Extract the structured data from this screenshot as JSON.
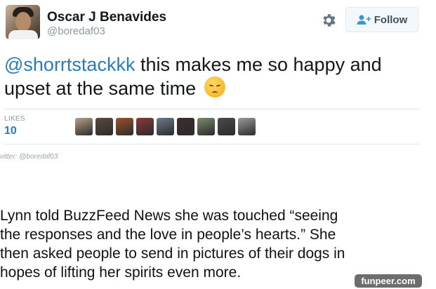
{
  "tweet": {
    "user": {
      "name": "Oscar J Benavides",
      "handle": "@boredaf03"
    },
    "follow_label": "Follow",
    "text": {
      "mention": "@shorrtstackkk",
      "line1_rest": " this makes me so happy and",
      "line2": "upset at the same time"
    },
    "emoji": "pensive-face",
    "likes": {
      "label": "LIKES",
      "count": "10",
      "avatar_colors": [
        "#b7a08a",
        "#5a4a3e",
        "#a0522d",
        "#8b3a3a",
        "#6b7b8c",
        "#3b2f2f",
        "#7a8b6a",
        "#4a4a4a",
        "#9a9a9a"
      ]
    }
  },
  "source_text": "vitter: @boredaf03",
  "article": {
    "lines": [
      "Lynn told BuzzFeed News she was touched “seeing",
      "the responses and the love in people’s hearts.” She",
      "then asked people to send in pictures of their dogs in",
      "hopes of lifting her spirits even more."
    ]
  },
  "watermark": "funpeer.com",
  "colors": {
    "link": "#2b7bb9",
    "muted": "#8899a6",
    "follow_icon": "#3b94d9"
  }
}
